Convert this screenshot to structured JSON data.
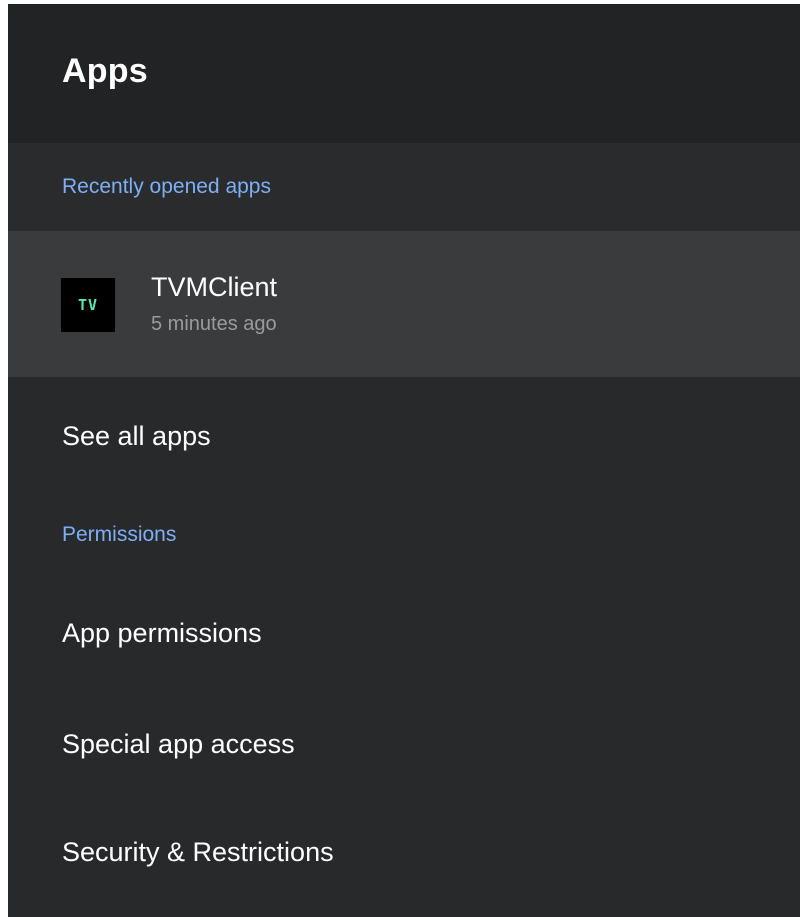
{
  "header": {
    "title": "Apps"
  },
  "recent_section": {
    "label": "Recently opened apps",
    "apps": [
      {
        "icon_text": "TV",
        "icon": "tvmclient-app-icon",
        "name": "TVMClient",
        "last_opened": "5 minutes ago"
      }
    ]
  },
  "see_all": {
    "label": "See all apps"
  },
  "permissions_section": {
    "label": "Permissions",
    "items": [
      {
        "label": "App permissions"
      },
      {
        "label": "Special app access"
      },
      {
        "label": "Security & Restrictions"
      }
    ]
  },
  "colors": {
    "background": "#28292b",
    "header_background": "#222325",
    "selected_row": "#3a3b3d",
    "section_accent": "#7eaff5",
    "app_icon_text": "#57e6b5"
  }
}
